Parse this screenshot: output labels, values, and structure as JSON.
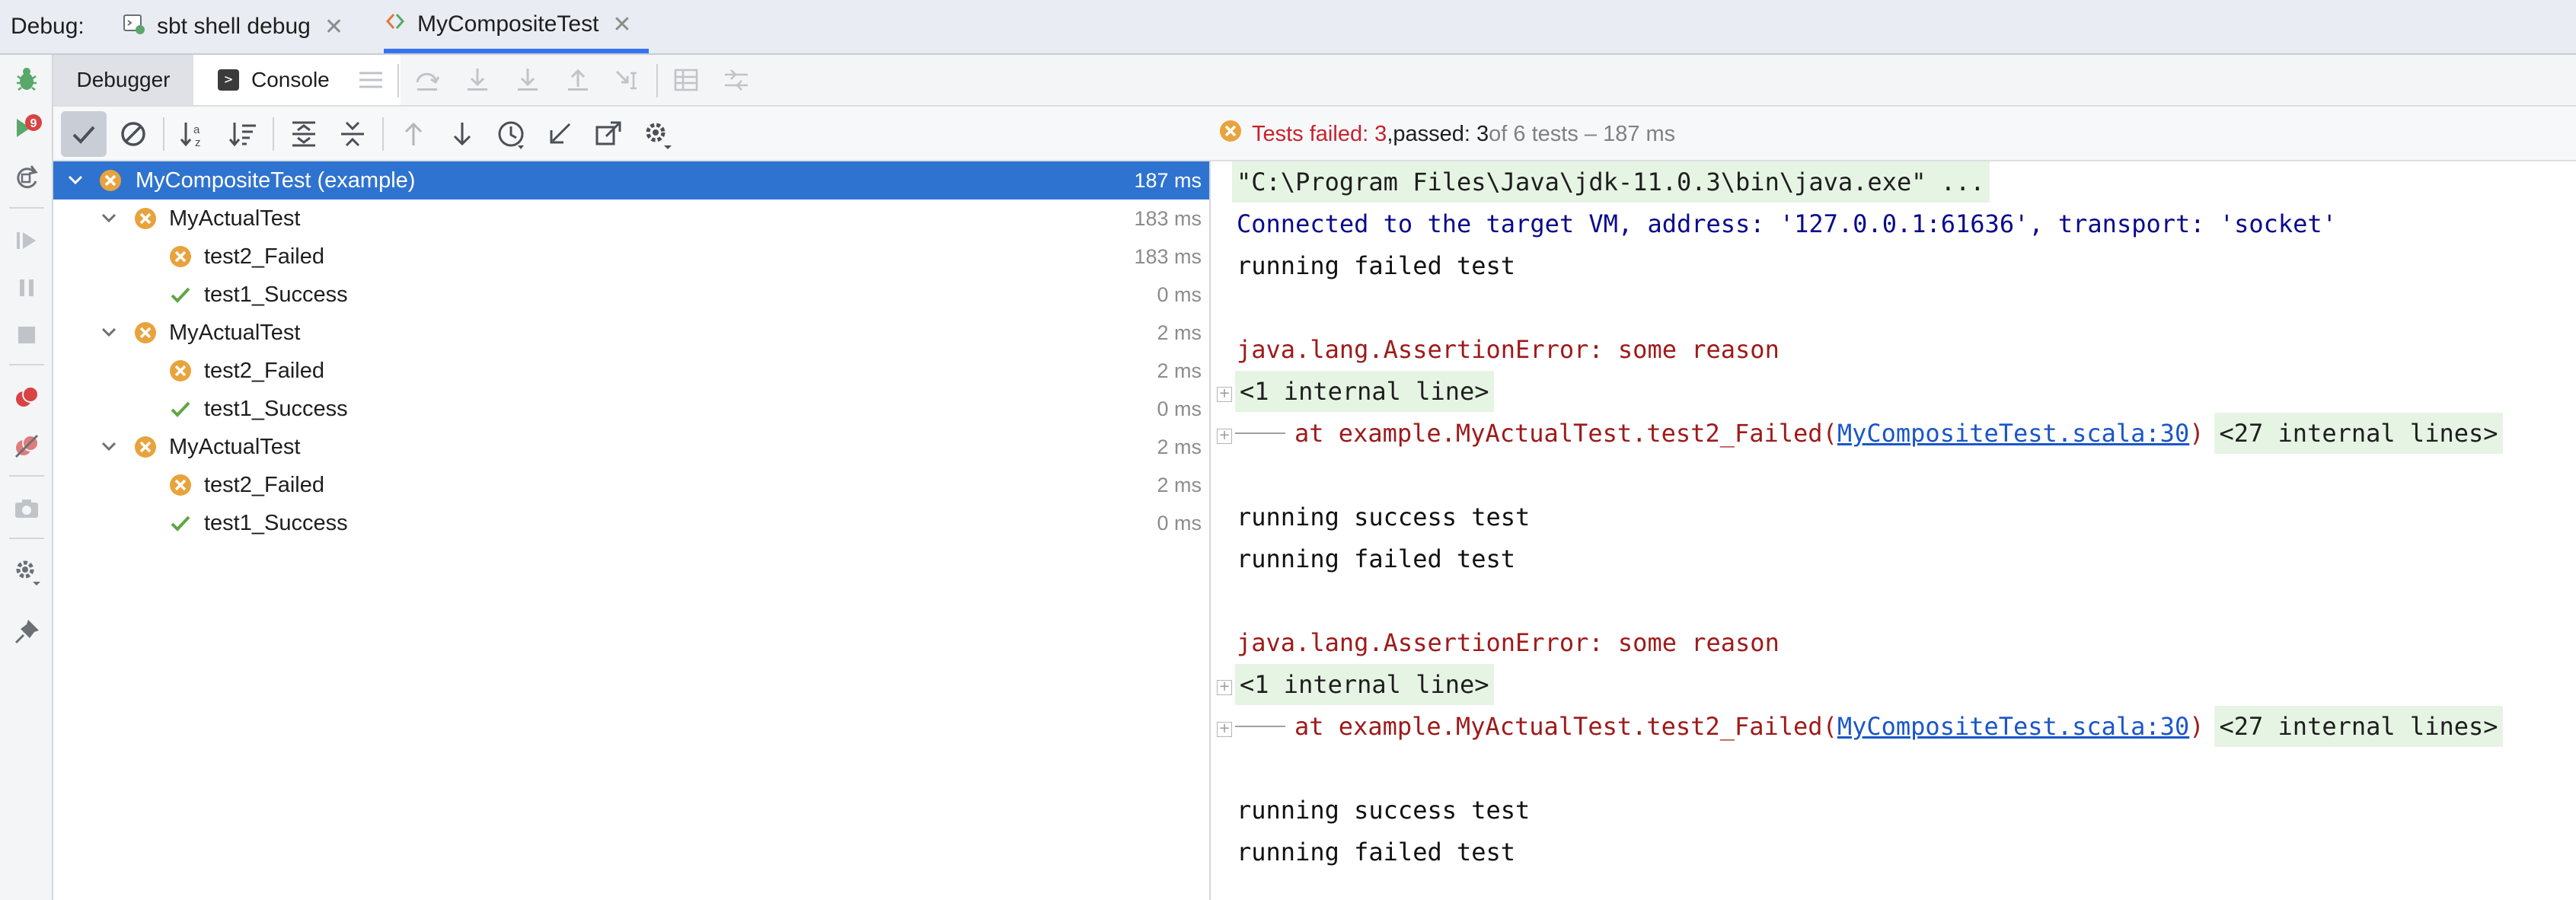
{
  "topbar": {
    "debug_label": "Debug:",
    "tabs": [
      {
        "label": "sbt shell debug",
        "active": false
      },
      {
        "label": "MyCompositeTest",
        "active": true
      }
    ]
  },
  "toolbar": {
    "tabs": [
      {
        "label": "Debugger",
        "selected": false
      },
      {
        "label": "Console",
        "selected": true
      }
    ],
    "rerun_badge": "9"
  },
  "status": {
    "failed_text": "Tests failed: 3",
    "separator": ", ",
    "passed_text": "passed: 3",
    "rest_text": " of 6 tests – 187 ms"
  },
  "tree": {
    "root": {
      "name": "MyCompositeTest (example)",
      "duration": "187 ms",
      "status": "failed"
    },
    "groups": [
      {
        "name": "MyActualTest",
        "duration": "183 ms",
        "status": "failed",
        "tests": [
          {
            "name": "test2_Failed",
            "duration": "183 ms",
            "status": "failed"
          },
          {
            "name": "test1_Success",
            "duration": "0 ms",
            "status": "passed"
          }
        ]
      },
      {
        "name": "MyActualTest",
        "duration": "2 ms",
        "status": "failed",
        "tests": [
          {
            "name": "test2_Failed",
            "duration": "2 ms",
            "status": "failed"
          },
          {
            "name": "test1_Success",
            "duration": "0 ms",
            "status": "passed"
          }
        ]
      },
      {
        "name": "MyActualTest",
        "duration": "2 ms",
        "status": "failed",
        "tests": [
          {
            "name": "test2_Failed",
            "duration": "2 ms",
            "status": "failed"
          },
          {
            "name": "test1_Success",
            "duration": "0 ms",
            "status": "passed"
          }
        ]
      }
    ]
  },
  "console": {
    "command": "\"C:\\Program Files\\Java\\jdk-11.0.3\\bin\\java.exe\" ...",
    "connected": "Connected to the target VM, address: '127.0.0.1:61636', transport: 'socket'",
    "blocks": [
      {
        "running1": "running failed test",
        "error": "java.lang.AssertionError: some reason",
        "internal": "<1 internal line>",
        "at_prefix": "at example.MyActualTest.test2_Failed(",
        "link": "MyCompositeTest.scala:30",
        "at_suffix": ")",
        "more": "<27 internal lines>",
        "running2": "running success test"
      },
      {
        "running1": "running failed test",
        "error": "java.lang.AssertionError: some reason",
        "internal": "<1 internal line>",
        "at_prefix": "at example.MyActualTest.test2_Failed(",
        "link": "MyCompositeTest.scala:30",
        "at_suffix": ")",
        "more": "<27 internal lines>",
        "running2": "running success test"
      }
    ],
    "last_line": "running failed test"
  },
  "colors": {
    "accent": "#3574f0",
    "selection": "#2f73d0",
    "fail": "#e8a33d",
    "pass": "#5fa642",
    "error_text": "#9e1a1a",
    "link": "#1a56c8"
  }
}
